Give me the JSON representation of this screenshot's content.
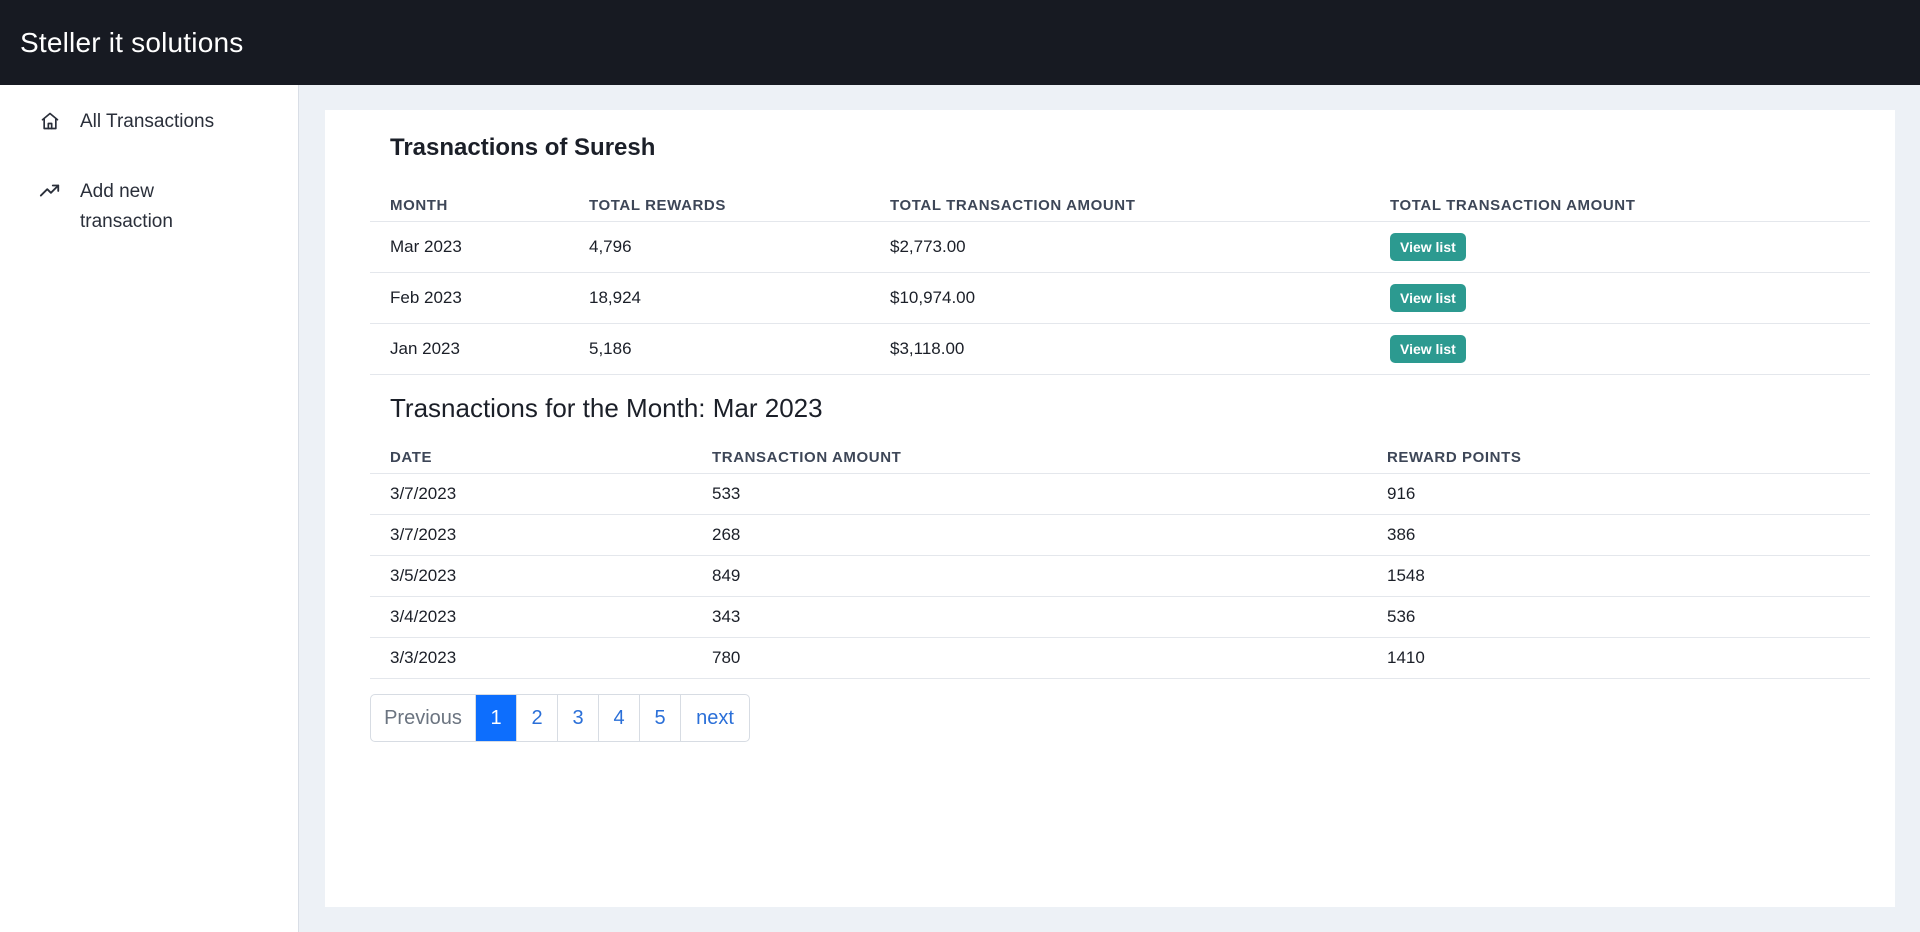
{
  "app": {
    "brand": "Steller it solutions"
  },
  "sidebar": {
    "items": [
      {
        "label": "All Transactions",
        "icon": "home-icon"
      },
      {
        "label": "Add new transaction",
        "icon": "trending-up-icon"
      }
    ]
  },
  "summary": {
    "title": "Trasnactions of Suresh",
    "columns": [
      "MONTH",
      "TOTAL REWARDS",
      "TOTAL TRANSACTION AMOUNT",
      "TOTAL TRANSACTION AMOUNT"
    ],
    "rows": [
      {
        "month": "Mar 2023",
        "rewards": "4,796",
        "amount": "$2,773.00",
        "action": "View list"
      },
      {
        "month": "Feb 2023",
        "rewards": "18,924",
        "amount": "$10,974.00",
        "action": "View list"
      },
      {
        "month": "Jan 2023",
        "rewards": "5,186",
        "amount": "$3,118.00",
        "action": "View list"
      }
    ]
  },
  "monthly": {
    "title": "Trasnactions for the Month: Mar 2023",
    "columns": [
      "DATE",
      "TRANSACTION AMOUNT",
      "REWARD POINTS"
    ],
    "rows": [
      {
        "date": "3/7/2023",
        "amount": "533",
        "points": "916"
      },
      {
        "date": "3/7/2023",
        "amount": "268",
        "points": "386"
      },
      {
        "date": "3/5/2023",
        "amount": "849",
        "points": "1548"
      },
      {
        "date": "3/4/2023",
        "amount": "343",
        "points": "536"
      },
      {
        "date": "3/3/2023",
        "amount": "780",
        "points": "1410"
      }
    ]
  },
  "pagination": {
    "previous": "Previous",
    "pages": [
      "1",
      "2",
      "3",
      "4",
      "5"
    ],
    "active": "1",
    "next": "next"
  },
  "colors": {
    "topbar": "#171a22",
    "button": "#2c9a90",
    "active_page": "#0d6efd",
    "link": "#2a6fd8"
  }
}
